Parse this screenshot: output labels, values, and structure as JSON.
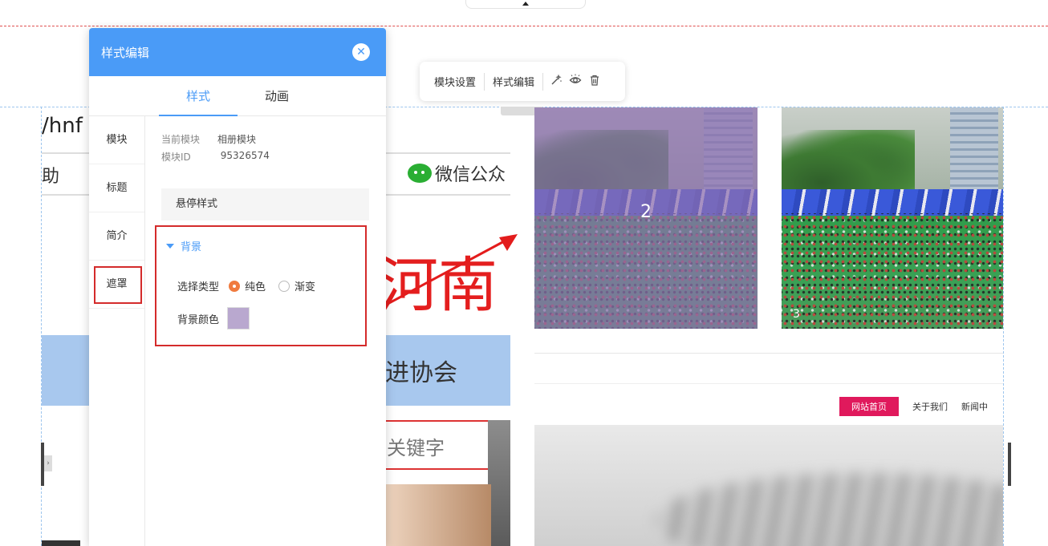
{
  "toolbar": {
    "module_settings": "模块设置",
    "style_edit": "样式编辑",
    "icons": [
      "magic-wand-icon",
      "eye-icon",
      "trash-icon"
    ]
  },
  "background_page": {
    "url_fragment": "/hnf",
    "nav_fragment": "助",
    "wechat_label": "微信公众",
    "big_title_fragment": "河南",
    "band_text": "进协会",
    "search_placeholder": "关键字"
  },
  "gallery": {
    "photos": [
      {
        "number": "2",
        "overlay_color": "#8e6fb0"
      },
      {
        "number": "3"
      }
    ],
    "mini_nav": [
      "网站首页",
      "关于我们",
      "新闻中"
    ]
  },
  "panel": {
    "title": "样式编辑",
    "close_icon": "close-icon",
    "tabs": [
      {
        "label": "样式",
        "active": true
      },
      {
        "label": "动画",
        "active": false
      }
    ],
    "side_items": [
      {
        "label": "模块",
        "active": false
      },
      {
        "label": "标题",
        "active": false
      },
      {
        "label": "简介",
        "active": false
      },
      {
        "label": "遮罩",
        "active": true
      }
    ],
    "current_module_label": "当前模块",
    "current_module_value": "相册模块",
    "module_id_label": "模块ID",
    "module_id_value": "95326574",
    "hover_style": "悬停样式",
    "background_section": "背景",
    "select_type_label": "选择类型",
    "type_options": [
      {
        "label": "纯色",
        "checked": true
      },
      {
        "label": "渐变",
        "checked": false
      }
    ],
    "bg_color_label": "背景颜色",
    "bg_color_value": "#b9a8cf"
  },
  "colors": {
    "accent": "#4a9bf7",
    "highlight_red": "#d42b2b",
    "radio_orange": "#f07b3f",
    "nav_active": "#e0195c"
  }
}
